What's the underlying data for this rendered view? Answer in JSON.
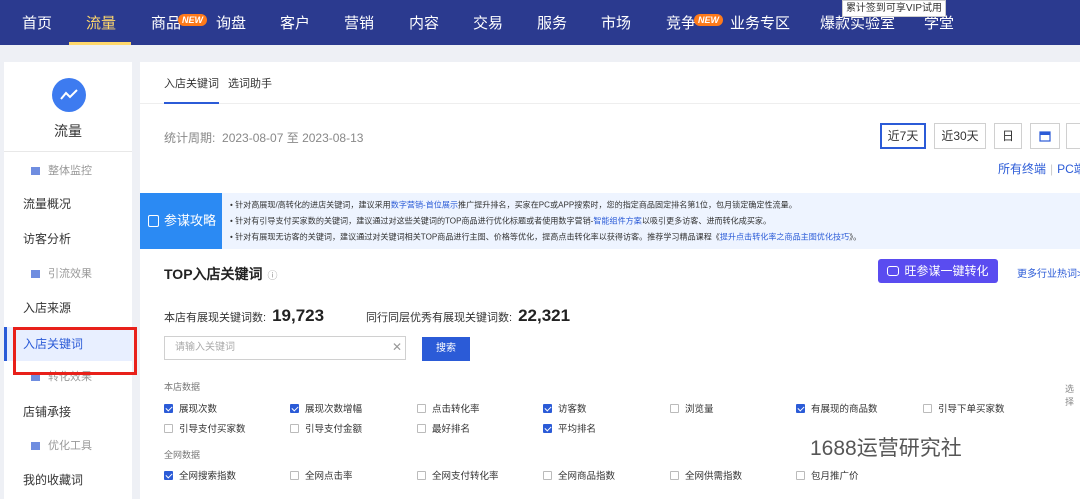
{
  "topnav": {
    "items": [
      "首页",
      "流量",
      "商品",
      "询盘",
      "客户",
      "营销",
      "内容",
      "交易",
      "服务",
      "市场",
      "竞争",
      "业务专区",
      "爆款实验室",
      "学堂"
    ],
    "badge": "NEW",
    "tooltip": "累计签到可享VIP试用"
  },
  "sidebar": {
    "title": "流量",
    "items": [
      "整体监控",
      "流量概况",
      "访客分析",
      "引流效果",
      "入店来源",
      "入店关键词",
      "转化效果",
      "店铺承接",
      "优化工具",
      "我的收藏词"
    ]
  },
  "tabs": [
    "入店关键词",
    "选词助手"
  ],
  "period": {
    "label": "统计周期:",
    "value": "2023-08-07 至 2023-08-13",
    "buttons": [
      "近7天",
      "近30天",
      "日"
    ],
    "terminal": [
      "所有终端",
      "PC端"
    ]
  },
  "tips": {
    "label": "参谋攻略",
    "lines": [
      [
        "• 针对高展现/高转化的进店关键词，建议采用",
        "数字营销-首位展示",
        "推广提升排名，买家在PC或APP搜索时，您的指定商品固定排名第1位，包月锁定确定性流量。"
      ],
      [
        "• 针对有引导支付买家数的关键词，建议通过对这些关键词的TOP商品进行优化标题或者使用数字营销-",
        "智能组件方案",
        "以吸引更多访客、进而转化成买家。"
      ],
      [
        "• 针对有展现无访客的关键词，建议通过对关键词相关TOP商品进行主图、价格等优化，提高点击转化率以获得访客。推荐学习精品课程《",
        "提升点击转化率之商品主图优化技巧",
        "》。"
      ]
    ]
  },
  "section": {
    "title": "TOP入店关键词",
    "help": "ⓘ",
    "wang_btn": "旺参谋一键转化",
    "more": "更多行业热词>"
  },
  "stats": {
    "shop_label": "本店有展现关键词数:",
    "shop_value": "19,723",
    "peer_label": "同行同层优秀有展现关键词数:",
    "peer_value": "22,321"
  },
  "search": {
    "placeholder": "请输入关键词",
    "clear": "✕",
    "button": "搜索"
  },
  "groups": {
    "shop": "本店数据",
    "all": "全网数据",
    "right_hint": "选择"
  },
  "checkboxes": {
    "row1": [
      {
        "label": "展现次数",
        "on": true
      },
      {
        "label": "展现次数增幅",
        "on": true
      },
      {
        "label": "点击转化率",
        "on": false
      },
      {
        "label": "访客数",
        "on": true
      },
      {
        "label": "浏览量",
        "on": false
      },
      {
        "label": "有展现的商品数",
        "on": true
      },
      {
        "label": "引导下单买家数",
        "on": false
      }
    ],
    "row2": [
      {
        "label": "引导支付买家数",
        "on": false
      },
      {
        "label": "引导支付金额",
        "on": false
      },
      {
        "label": "最好排名",
        "on": false
      },
      {
        "label": "平均排名",
        "on": true
      }
    ],
    "row3": [
      {
        "label": "全网搜索指数",
        "on": true
      },
      {
        "label": "全网点击率",
        "on": false
      },
      {
        "label": "全网支付转化率",
        "on": false
      },
      {
        "label": "全网商品指数",
        "on": false
      },
      {
        "label": "全网供需指数",
        "on": false
      },
      {
        "label": "包月推广价",
        "on": false
      }
    ]
  },
  "watermark": "1688运营研究社",
  "colors": {
    "nav": "#2b3a8f",
    "accent": "#2b5bd7",
    "highlight": "#ffd86b",
    "red_box": "#e8201a",
    "tips_label": "#2b8af3",
    "wang": "#5a4cf0"
  }
}
